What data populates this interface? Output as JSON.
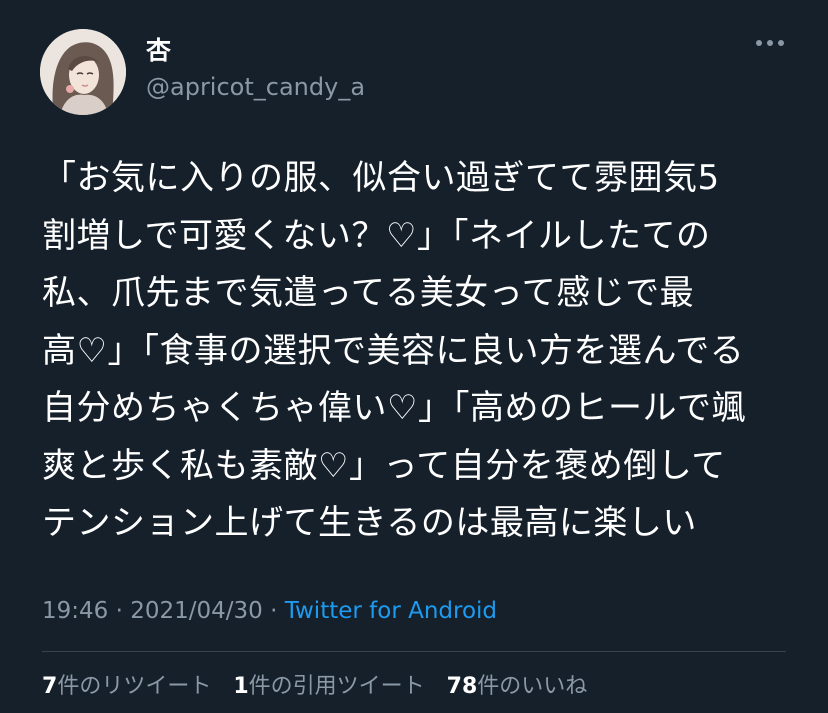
{
  "user": {
    "display_name": "杏",
    "handle": "@apricot_candy_a",
    "avatar_icon": "avatar-illustration"
  },
  "tweet": {
    "lines": [
      "「お気に入りの服、似合い過ぎてて雰囲気5",
      "割増しで可愛くない？♡」「ネイルしたての",
      "私、爪先まで気遣ってる美女って感じで最",
      "高♡」「食事の選択で美容に良い方を選んでる",
      "自分めちゃくちゃ偉い♡」「高めのヒールで颯",
      "爽と歩く私も素敵♡」って自分を褒め倒して",
      "テンション上げて生きるのは最高に楽しい"
    ]
  },
  "meta": {
    "time": "19:46",
    "sep1": " · ",
    "date": "2021/04/30",
    "sep2": " · ",
    "source": "Twitter for Android"
  },
  "stats": {
    "retweets_count": "7",
    "retweets_label": "件のリツイート",
    "quotes_count": "1",
    "quotes_label": "件の引用ツイート",
    "likes_count": "78",
    "likes_label": "件のいいね"
  },
  "colors": {
    "background": "#15202b",
    "secondary_text": "#8b98a5",
    "link": "#1d9bf0",
    "divider": "#38444d"
  }
}
